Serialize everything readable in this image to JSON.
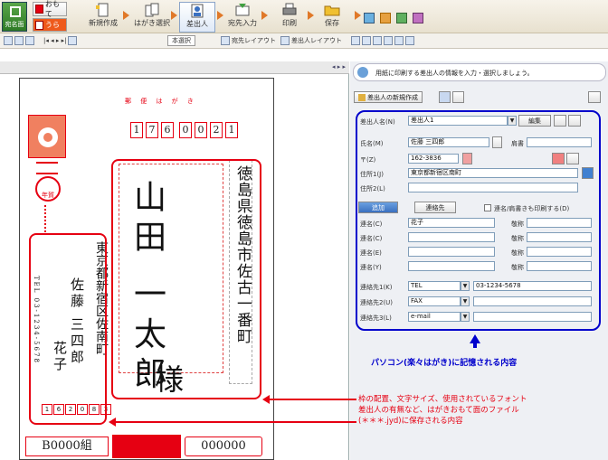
{
  "ribbon": {
    "btn_design": "宛名面",
    "btn_face": "おもて",
    "btn_back": "うら",
    "steps": [
      "新規作成",
      "はがき選択",
      "差出人",
      "宛先入力",
      "印刷",
      "保存"
    ]
  },
  "toolbar2": {
    "std_label": "本選択",
    "layout1": "宛先レイアウト",
    "layout2": "差出人レイアウト"
  },
  "nav_arrows": "◂ ▸ ▸",
  "card": {
    "header": "郵 便 は が き",
    "postal_digits": [
      "1",
      "7",
      "6",
      "0",
      "0",
      "2",
      "1"
    ],
    "recipient_address": "徳島県徳島市佐古一番町",
    "recipient_name": "山田 一太郎",
    "recipient_honorific": "様",
    "sender_address": "東京都新宿区佐南町",
    "sender_name_line1": "佐藤 三四郎",
    "sender_name_line2": "花子",
    "sender_tel": "TEL 03-1234-5678",
    "sender_postal_digits": [
      "1",
      "6",
      "2",
      "0",
      "8",
      "3"
    ],
    "stamp_label": "年賀",
    "bottom_left": "B0000組",
    "bottom_right": "000000"
  },
  "right": {
    "hint": "用紙に印刷する差出人の情報を入力・選択しましょう。",
    "sender_btn": "差出人の新規作成",
    "sender_label": "差出人名(N)",
    "sender_value": "差出人1",
    "edit_btn": "編集",
    "name_label": "氏名(M)",
    "name_value": "佐藤 三四郎",
    "title_label": "肩書",
    "zip_label": "〒(Z)",
    "zip_value": "162-3836",
    "addr1_label": "住所1(J)",
    "addr1_value": "東京都新宿区南町",
    "addr2_label": "住所2(L)",
    "add_btn": "追加",
    "contact_btn": "連絡先",
    "check_label": "連名/肩書きも印刷する(D)",
    "renmei_labels": [
      "連名(C)",
      "連名(C)",
      "連名(E)",
      "連名(Y)"
    ],
    "renmei_values": [
      "花子",
      "",
      "",
      ""
    ],
    "keisho_label": "敬称",
    "contacts": [
      {
        "label": "連絡先1(K)",
        "type": "TEL",
        "value": "03-1234-5678"
      },
      {
        "label": "連絡先2(U)",
        "type": "FAX",
        "value": ""
      },
      {
        "label": "連絡先3(L)",
        "type": "e-mail",
        "value": ""
      }
    ]
  },
  "annotations": {
    "blue": "パソコン(楽々はがき)に記憶される内容",
    "red_line1": "枠の配置、文字サイズ、使用されているフォント",
    "red_line2": "差出人の有無など、はがきおもて面のファイル",
    "red_line3": "(＊＊＊.jyd)に保存される内容"
  },
  "colors": {
    "accent_red": "#e60012",
    "accent_blue": "#0000cc",
    "ribbon_orange": "#e07828"
  }
}
